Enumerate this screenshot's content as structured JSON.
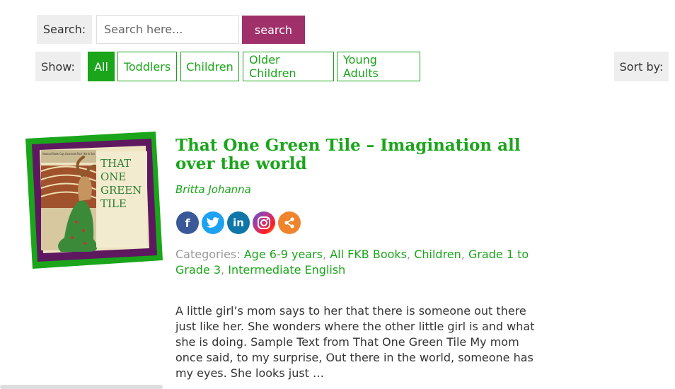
{
  "search": {
    "label": "Search:",
    "placeholder": "Search here...",
    "value": "",
    "button_label": "search"
  },
  "filters": {
    "show_label": "Show:",
    "options": [
      "All",
      "Toddlers",
      "Children",
      "Older Children",
      "Young Adults"
    ],
    "active": "All"
  },
  "sort": {
    "label": "Sort by:"
  },
  "book": {
    "title": "That One Green Tile – Imagination all over the world",
    "author": "Britta Johanna",
    "cover_text_title": "THAT ONE GREEN TILE",
    "cover_text_note": "Advanced Reader Copy Uncorrected Proof - Not for Sale",
    "social_icons": [
      "facebook-icon",
      "twitter-icon",
      "linkedin-icon",
      "instagram-icon",
      "share-icon"
    ],
    "categories_label": "Categories:",
    "categories": [
      "Age 6-9 years",
      "All FKB Books",
      "Children",
      "Grade 1 to Grade 3",
      "Intermediate English"
    ],
    "description": "A little girl’s mom says to her that there is someone out there just like her. She wonders where the other little girl is and what she is doing. Sample Text from That One Green Tile My mom once said, to my surprise, Out there in the world, someone has my eyes. She looks just …"
  },
  "colors": {
    "brand_green": "#1aa51a",
    "search_button": "#a0306a",
    "label_bg": "#eeeeee",
    "cover_frame_purple": "#5e1860"
  }
}
